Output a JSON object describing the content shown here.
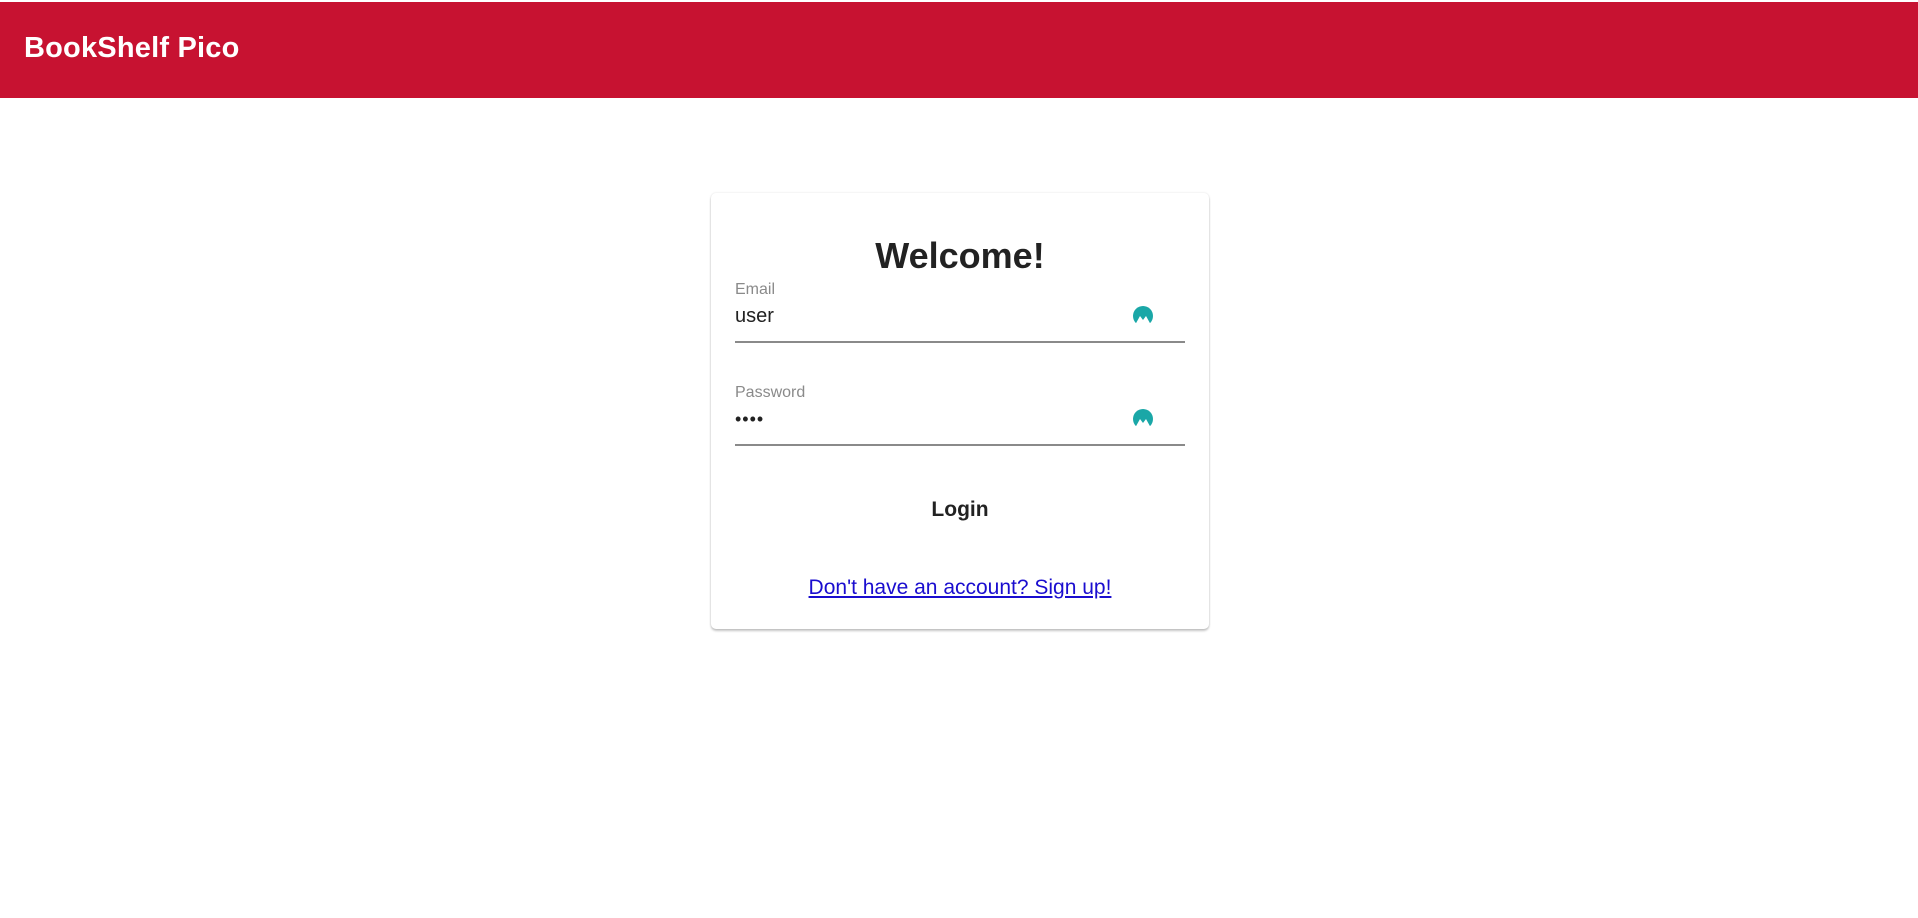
{
  "header": {
    "app_title": "BookShelf Pico",
    "background_color": "#c71231"
  },
  "login_card": {
    "title": "Welcome!",
    "email": {
      "label": "Email",
      "value": "user",
      "icon": "password-manager-icon"
    },
    "password": {
      "label": "Password",
      "value": "••••",
      "icon": "password-manager-icon"
    },
    "login_label": "Login",
    "signup_link": "Don't have an account? Sign up!"
  },
  "colors": {
    "accent": "#c71231",
    "icon": "#1aa7a7",
    "link": "#1a0dcf"
  }
}
